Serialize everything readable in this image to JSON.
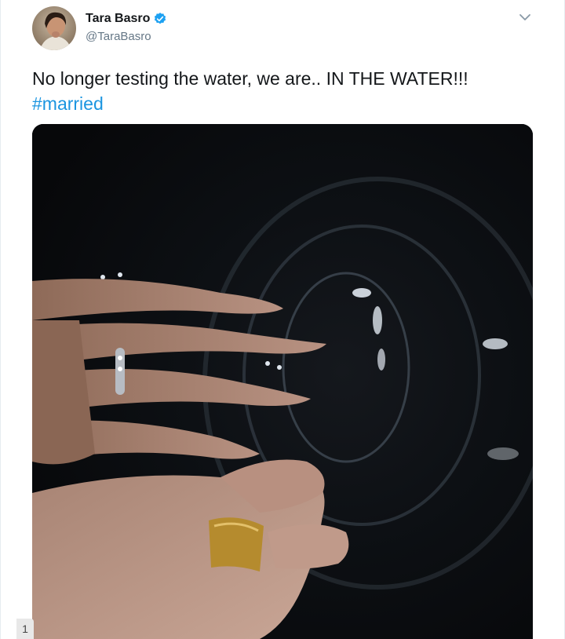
{
  "tweet": {
    "author": {
      "display_name": "Tara Basro",
      "handle": "@TaraBasro",
      "verified": true
    },
    "text": "No longer testing the water, we are.. IN THE WATER!!!",
    "hashtag": "#married",
    "media_description_icon": "photo",
    "counter": "1"
  },
  "colors": {
    "accent": "#1b95e0",
    "text": "#14171a",
    "secondary_text": "#657786",
    "verified_badge": "#1da1f2"
  }
}
